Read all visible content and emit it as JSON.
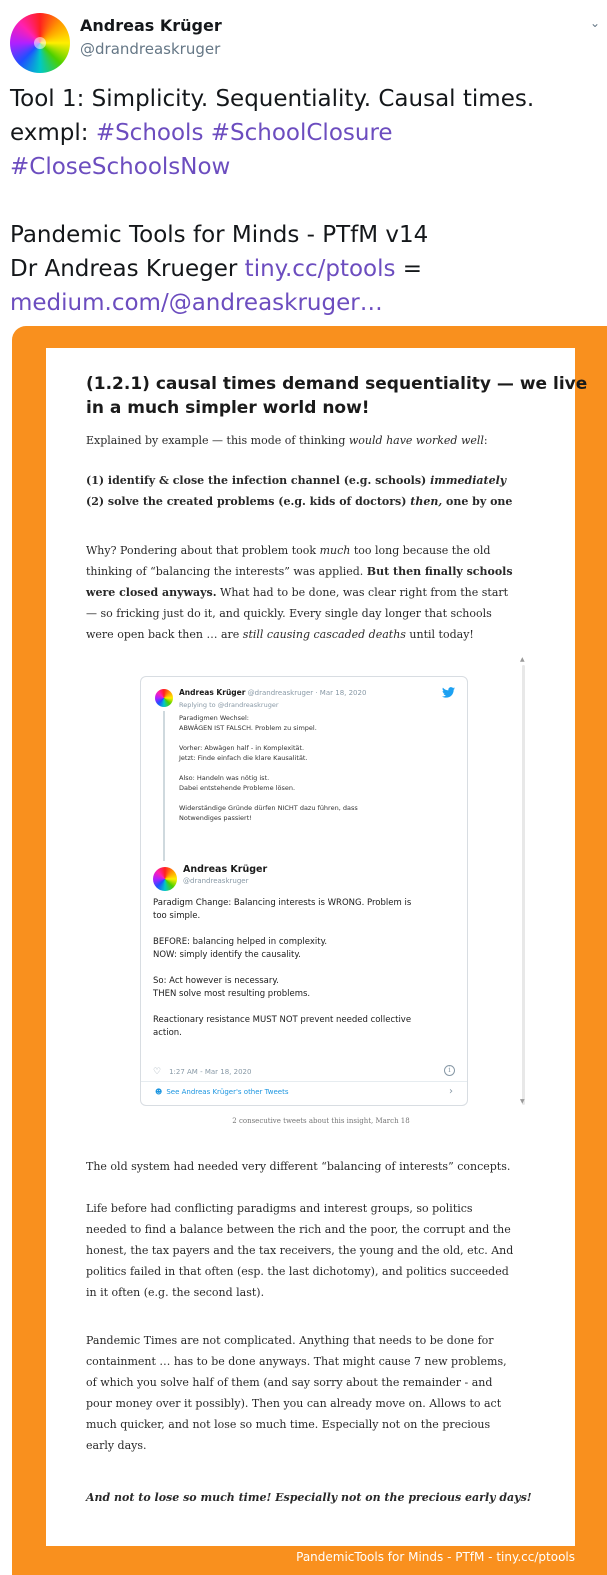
{
  "tweet": {
    "author_name": "Andreas Krüger",
    "author_handle": "@drandreaskruger",
    "line1": "Tool 1: Simplicity. Sequentiality. Causal times.",
    "line2_prefix": "exmpl: ",
    "hashtag_schools": "#Schools",
    "hashtag_schoolclosure": "#SchoolClosure",
    "hashtag_closeschoolsnow": "#CloseSchoolsNow",
    "line4": "Pandemic Tools for Minds - PTfM v14",
    "line5_prefix": "Dr Andreas Krueger ",
    "link1": "tiny.cc/ptools",
    "line5_suffix": " =",
    "link2": "medium.com/@andreaskruger…"
  },
  "image": {
    "title_line1": "(1.2.1) causal times demand sequentiality — we live",
    "title_line2": "in a much simpler world now!",
    "intro_a": "Explained by example — this mode of thinking ",
    "intro_b": "would have worked well",
    "intro_c": ":",
    "step1_a": "(1) identify & close the infection channel (e.g. schools) ",
    "step1_b": "immediately",
    "step2_a": "(2) solve the created problems (e.g. kids of doctors) ",
    "step2_b": "then,",
    "step2_c": " one by one",
    "why_l1a": "Why? Pondering about that problem took ",
    "why_l1b": "much",
    "why_l1c": " too long because the old",
    "why_l2a": "thinking of “balancing the interests” was applied. ",
    "why_l2b": "But then finally schools",
    "why_l3a": "were closed anyways.",
    "why_l3b": " What had to be done, was clear right from the start",
    "why_l4": "— so fricking just do it, and quickly. Every single day longer that schools",
    "why_l5a": "were open back then … are ",
    "why_l5b": "still causing cascaded deaths",
    "why_l5c": " until today!",
    "embed": {
      "name1": "Andreas Krüger",
      "meta1": " @drandreaskruger · Mar 18, 2020",
      "replying": "Replying to @drandreaskruger",
      "de_lines": [
        "Paradigmen Wechsel:",
        "ABWÄGEN IST FALSCH. Problem zu simpel.",
        "",
        "Vorher: Abwägen half - in Komplexität.",
        "Jetzt: Finde einfach die klare Kausalität.",
        "",
        "Also: Handeln was nötig ist.",
        "Dabei entstehende Probleme lösen.",
        "",
        "Widerständige Gründe dürfen NICHT dazu führen, dass",
        "Notwendiges passiert!"
      ],
      "name2": "Andreas Krüger",
      "handle2": "@drandreaskruger",
      "en_lines": [
        "Paradigm Change: Balancing interests is WRONG. Problem is",
        "too simple.",
        "",
        "BEFORE: balancing helped in complexity.",
        "NOW: simply identify the causality.",
        "",
        "So: Act however is necessary.",
        "THEN solve most resulting problems.",
        "",
        "Reactionary resistance MUST NOT prevent needed collective",
        "action."
      ],
      "timestamp": "1:27 AM - Mar 18, 2020",
      "more_link": "See Andreas Krüger's other Tweets"
    },
    "fig_caption": "2 consecutive tweets about this insight, March 18",
    "p1": "The old system had needed very different “balancing of interests” concepts.",
    "p2_lines": [
      "Life before had conflicting paradigms and interest groups, so politics",
      "needed to find a balance between the rich and the poor, the corrupt and the",
      "honest, the tax payers and the tax receivers, the young and the old, etc. And",
      "politics failed in that often (esp. the last dichotomy), and politics succeeded",
      "in it often (e.g. the second last)."
    ],
    "p3_lines": [
      "Pandemic Times are not complicated. Anything that needs to be done for",
      "containment … has to be done anyways. That might cause 7 new problems,",
      "of which you solve half of them (and say sorry about the remainder - and",
      "pour money over it possibly). Then you can already move on. Allows to act",
      "much quicker, and not lose so much time. Especially not on the precious",
      "early days."
    ],
    "p4": "And not to lose so much time! Especially not on the precious early days!",
    "footer": "PandemicTools for Minds - PTfM - tiny.cc/ptools"
  },
  "colors": {
    "link": "#6c4dbf",
    "frame": "#f9901e",
    "twitter_blue": "#1b95e0"
  }
}
